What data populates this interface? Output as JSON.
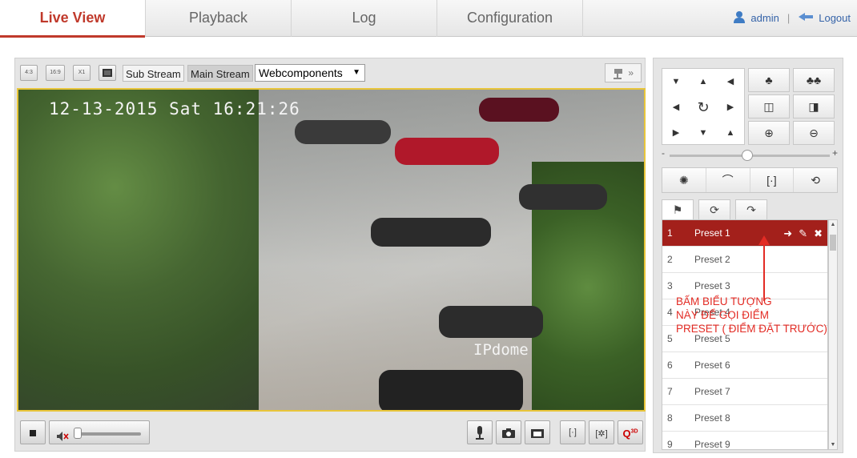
{
  "nav": {
    "tabs": [
      {
        "label": "Live View",
        "active": true
      },
      {
        "label": "Playback",
        "active": false
      },
      {
        "label": "Log",
        "active": false
      },
      {
        "label": "Configuration",
        "active": false
      }
    ],
    "user": "admin",
    "separator": "|",
    "logout": "Logout"
  },
  "toolbar": {
    "ratio_4_3": "4:3",
    "ratio_16_9": "16:9",
    "ratio_x1": "X1",
    "sub_stream": "Sub Stream",
    "main_stream": "Main Stream",
    "plugin_select": "Webcomponents",
    "expand_glyph": "»"
  },
  "video": {
    "osd_datetime": "12-13-2015 Sat 16:21:26",
    "osd_name": "IPdome"
  },
  "presets": [
    {
      "num": "1",
      "name": "Preset 1"
    },
    {
      "num": "2",
      "name": "Preset 2"
    },
    {
      "num": "3",
      "name": "Preset 3"
    },
    {
      "num": "4",
      "name": "Preset 4"
    },
    {
      "num": "5",
      "name": "Preset 5"
    },
    {
      "num": "6",
      "name": "Preset 6"
    },
    {
      "num": "7",
      "name": "Preset 7"
    },
    {
      "num": "8",
      "name": "Preset 8"
    },
    {
      "num": "9",
      "name": "Preset 9"
    }
  ],
  "annotation": {
    "line1": "BẤM BIỂU TƯỢNG",
    "line2": "NÀY ĐỂ GỌI ĐIỂM",
    "line3": "PRESET ( ĐIỂM ĐẶT TRƯỚC)"
  },
  "colors": {
    "accent": "#c0392b",
    "selected_row": "#a3201b",
    "annotation": "#e32b24",
    "video_border": "#e8c53a"
  },
  "zoom_sb_3d": "3D"
}
